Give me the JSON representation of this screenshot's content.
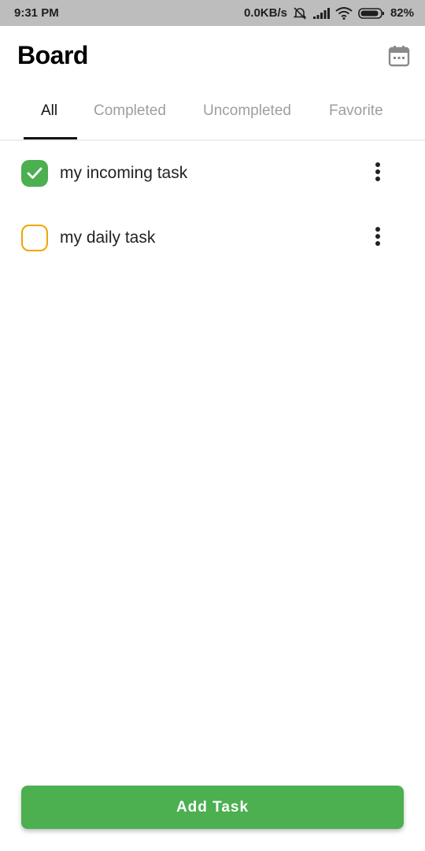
{
  "status_bar": {
    "time": "9:31 PM",
    "network_speed": "0.0KB/s",
    "battery": "82%",
    "icons": [
      "alarm-off-icon",
      "signal-icon",
      "wifi-icon",
      "battery-icon"
    ]
  },
  "header": {
    "title": "Board",
    "calendar_icon": "calendar-icon"
  },
  "tabs": [
    {
      "label": "All",
      "active": true
    },
    {
      "label": "Completed",
      "active": false
    },
    {
      "label": "Uncompleted",
      "active": false
    },
    {
      "label": "Favorite",
      "active": false
    }
  ],
  "tasks": [
    {
      "label": "my incoming task",
      "completed": true,
      "checkbox_color": "#4caf50"
    },
    {
      "label": "my daily task",
      "completed": false,
      "checkbox_color": "#f0a500"
    }
  ],
  "add_button": {
    "label": "Add Task"
  },
  "colors": {
    "accent": "#4caf50",
    "pending": "#f0a500",
    "status_bar": "#bdbdbd",
    "tab_inactive": "#9e9e9e"
  }
}
